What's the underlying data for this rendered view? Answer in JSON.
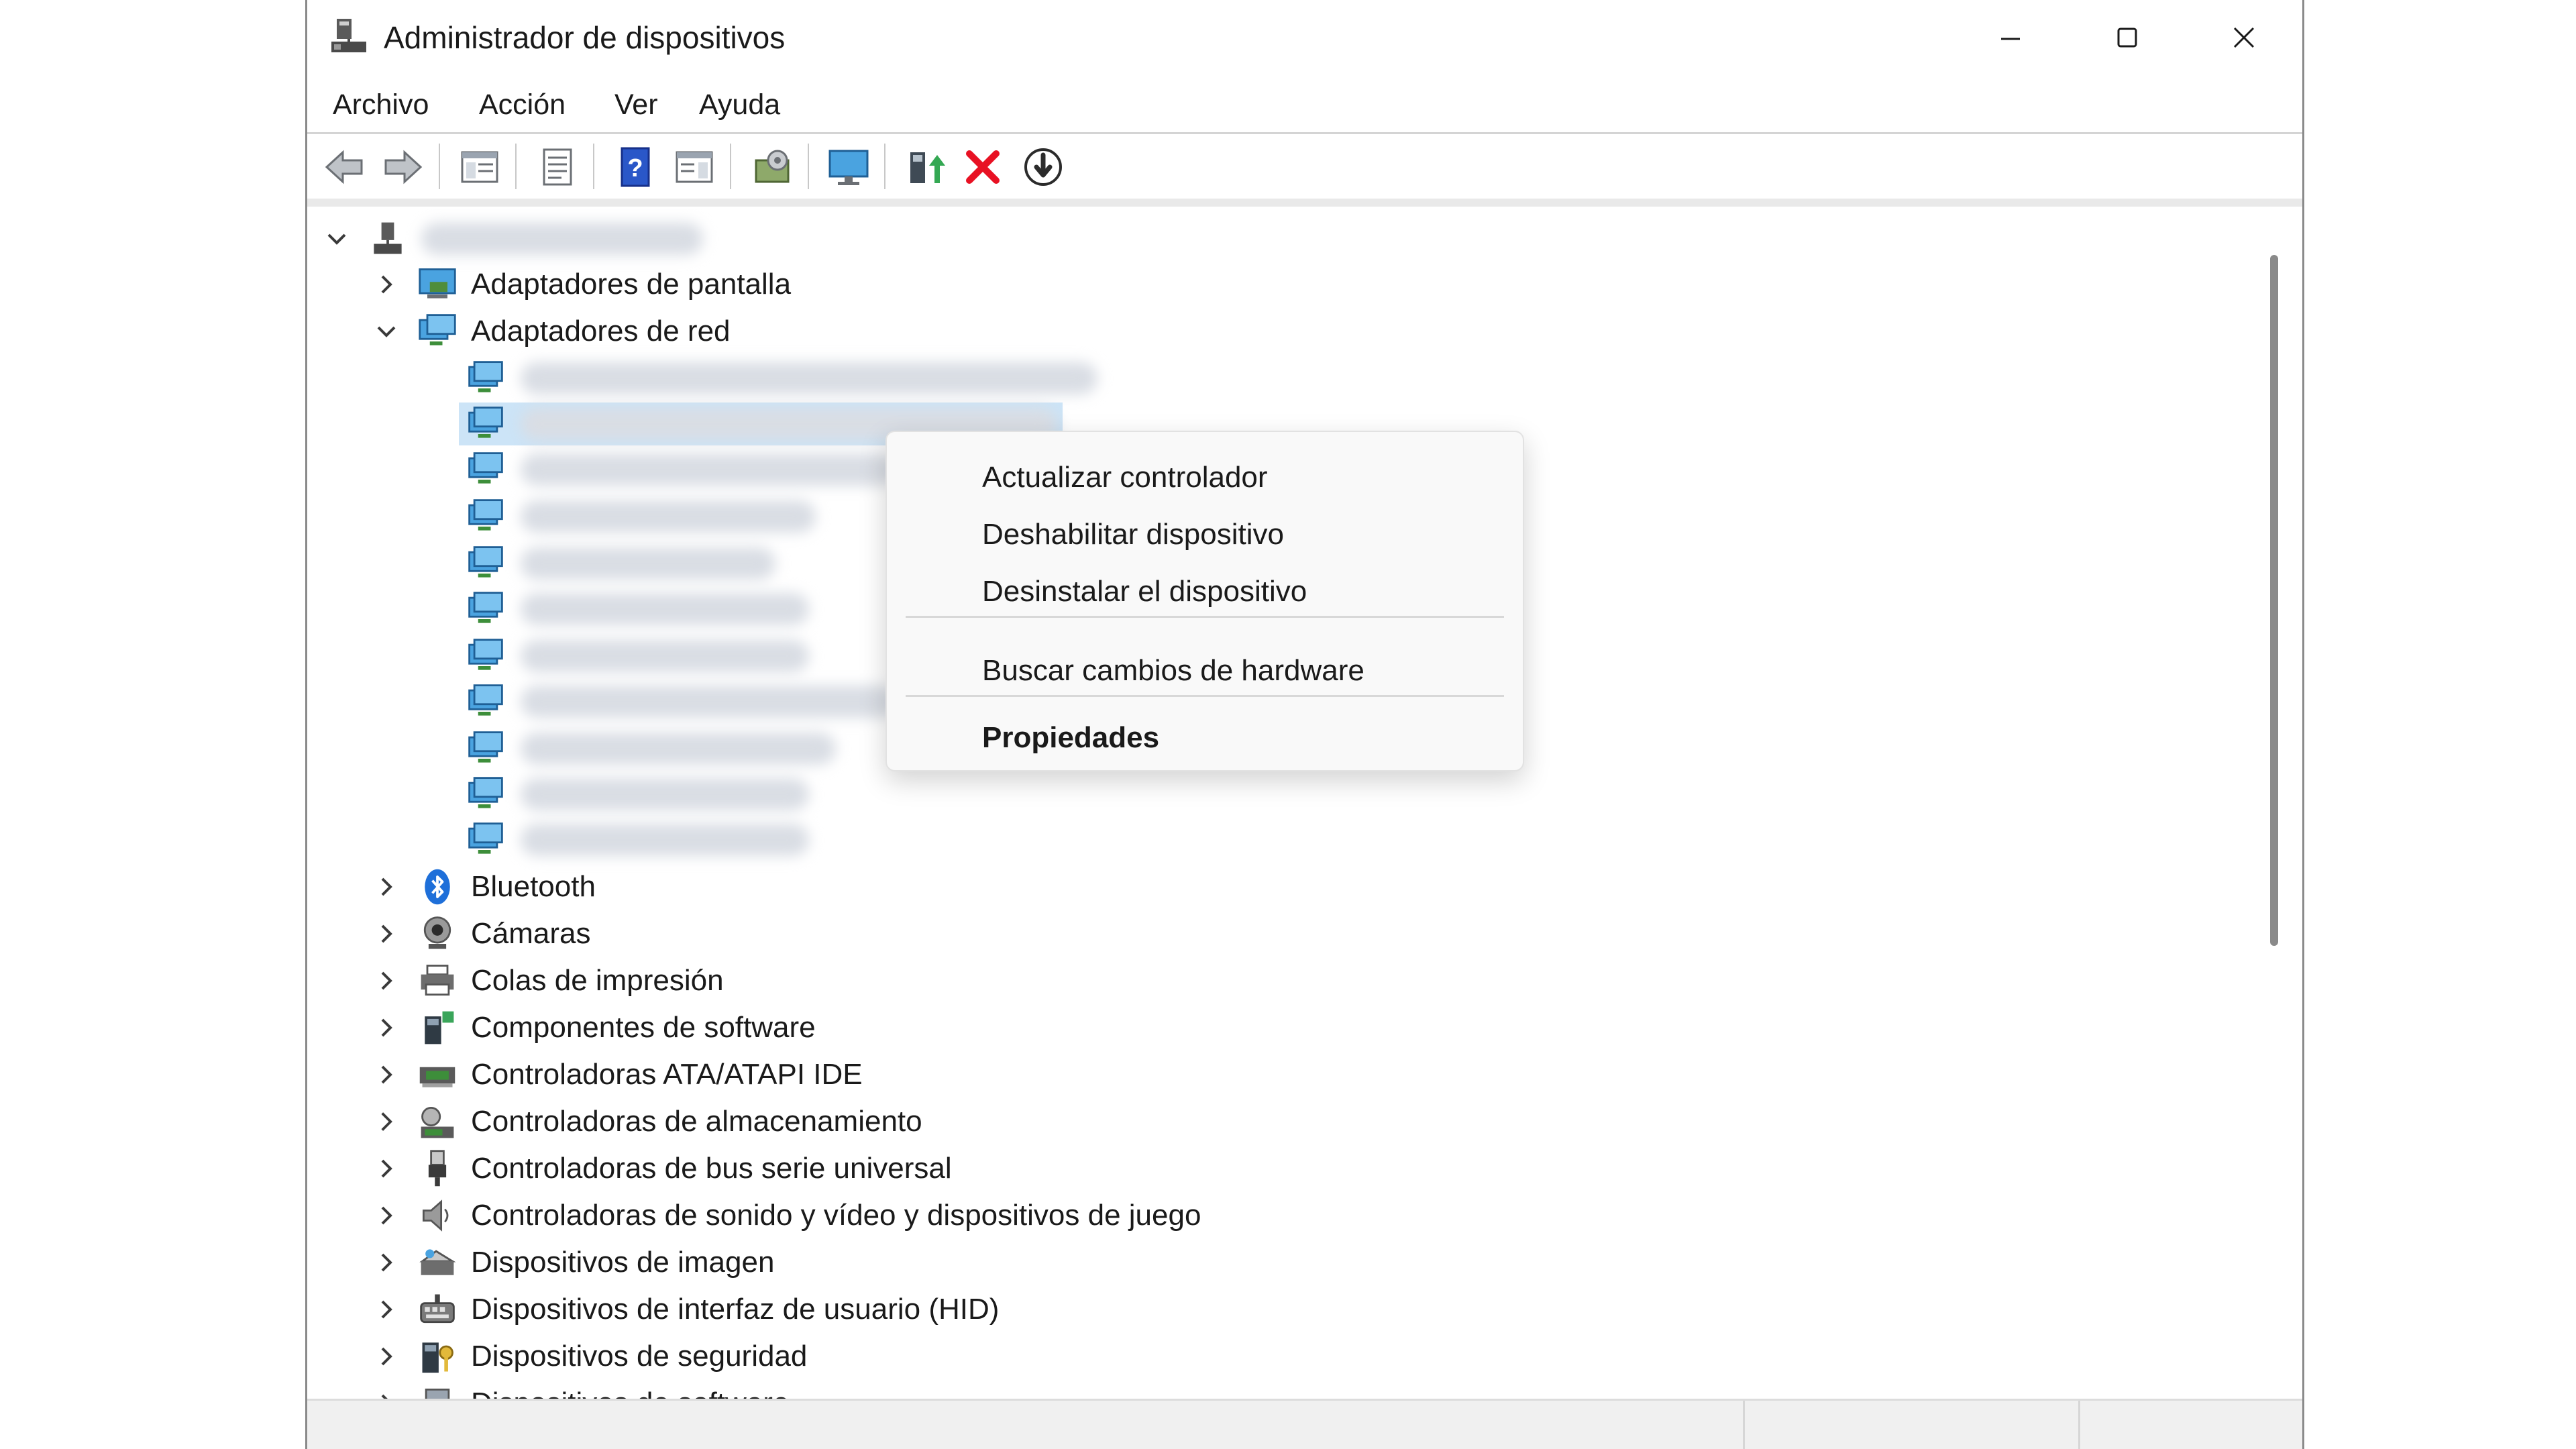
{
  "window": {
    "title": "Administrador de dispositivos",
    "title_icon": "device-manager-icon",
    "controls": [
      "minimize-icon",
      "maximize-icon",
      "close-icon"
    ]
  },
  "menu": [
    "Archivo",
    "Acción",
    "Ver",
    "Ayuda"
  ],
  "toolbar": [
    "back-arrow-icon",
    "forward-arrow-icon",
    "show-hide-tree-icon",
    "properties-sheet-icon",
    "help-icon",
    "action-pane-icon",
    "scan-hardware-icon",
    "monitor-icon",
    "update-driver-icon",
    "uninstall-icon",
    "disable-device-icon"
  ],
  "tree": {
    "categories": [
      {
        "label": "Adaptadores de pantalla",
        "icon": "display-adapter-icon",
        "expanded": false
      },
      {
        "label": "Adaptadores de red",
        "icon": "network-adapter-icon",
        "expanded": true
      },
      {
        "label": "Bluetooth",
        "icon": "bluetooth-icon",
        "expanded": false
      },
      {
        "label": "Cámaras",
        "icon": "camera-icon",
        "expanded": false
      },
      {
        "label": "Colas de impresión",
        "icon": "printer-icon",
        "expanded": false
      },
      {
        "label": "Componentes de software",
        "icon": "software-component-icon",
        "expanded": false
      },
      {
        "label": "Controladoras ATA/ATAPI IDE",
        "icon": "ide-controller-icon",
        "expanded": false
      },
      {
        "label": "Controladoras de almacenamiento",
        "icon": "storage-controller-icon",
        "expanded": false
      },
      {
        "label": "Controladoras de bus serie universal",
        "icon": "usb-icon",
        "expanded": false
      },
      {
        "label": "Controladoras de sonido y vídeo y dispositivos de juego",
        "icon": "speaker-icon",
        "expanded": false
      },
      {
        "label": "Dispositivos de imagen",
        "icon": "scanner-icon",
        "expanded": false
      },
      {
        "label": "Dispositivos de interfaz de usuario (HID)",
        "icon": "hid-icon",
        "expanded": false
      },
      {
        "label": "Dispositivos de seguridad",
        "icon": "security-device-icon",
        "expanded": false
      },
      {
        "label": "Dispositivos de software",
        "icon": "software-device-icon",
        "expanded": false
      }
    ]
  },
  "context_menu": {
    "items": [
      "Actualizar controlador",
      "Deshabilitar dispositivo",
      "Desinstalar el dispositivo",
      "Buscar cambios de hardware",
      "Propiedades"
    ],
    "default_item": "Propiedades"
  },
  "colors": {
    "accent": "#1e6fd9",
    "uninstall_red": "#e81123",
    "selection": "#cce4f7",
    "scroll_thumb": "#8a8a8a"
  }
}
